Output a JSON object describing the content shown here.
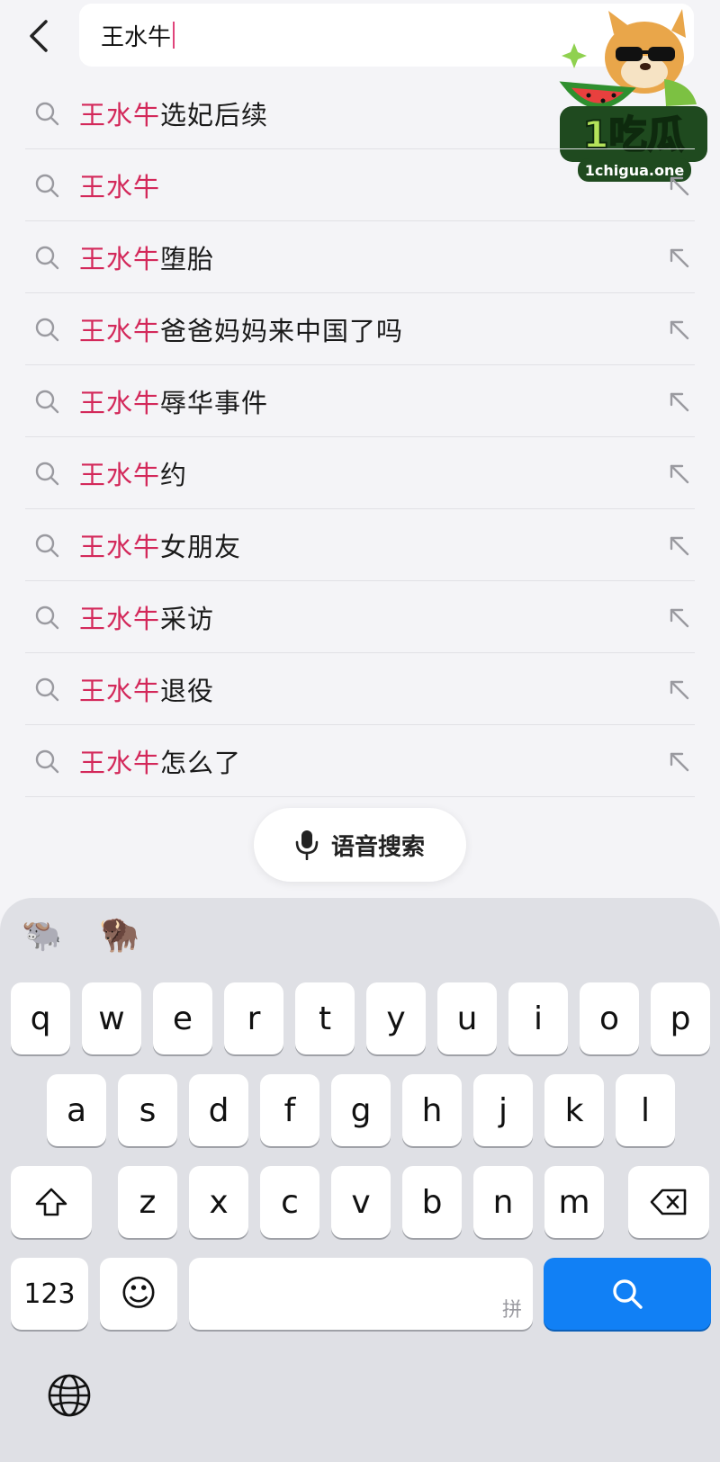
{
  "search": {
    "query": "王水牛",
    "clear_symbol": "×"
  },
  "logo": {
    "brand": "1吃瓜",
    "domain": "1chigua.one"
  },
  "suggestions": [
    {
      "highlight": "王水牛",
      "rest": "选妃后续"
    },
    {
      "highlight": "王水牛",
      "rest": ""
    },
    {
      "highlight": "王水牛",
      "rest": "堕胎"
    },
    {
      "highlight": "王水牛",
      "rest": "爸爸妈妈来中国了吗"
    },
    {
      "highlight": "王水牛",
      "rest": "辱华事件"
    },
    {
      "highlight": "王水牛",
      "rest": "约"
    },
    {
      "highlight": "王水牛",
      "rest": "女朋友"
    },
    {
      "highlight": "王水牛",
      "rest": "采访"
    },
    {
      "highlight": "王水牛",
      "rest": "退役"
    },
    {
      "highlight": "王水牛",
      "rest": "怎么了"
    }
  ],
  "voice_search": {
    "label": "语音搜索"
  },
  "keyboard": {
    "emoji_candidates": [
      "🐃",
      "🦬"
    ],
    "row1": [
      "q",
      "w",
      "e",
      "r",
      "t",
      "y",
      "u",
      "i",
      "o",
      "p"
    ],
    "row2": [
      "a",
      "s",
      "d",
      "f",
      "g",
      "h",
      "j",
      "k",
      "l"
    ],
    "row3": [
      "z",
      "x",
      "c",
      "v",
      "b",
      "n",
      "m"
    ],
    "numbers_label": "123",
    "emoji_key": "☺",
    "space_hint": "拼"
  },
  "colors": {
    "highlight": "#d3285a",
    "search_key": "#1180f5",
    "keyboard_bg": "#dfe0e5"
  }
}
